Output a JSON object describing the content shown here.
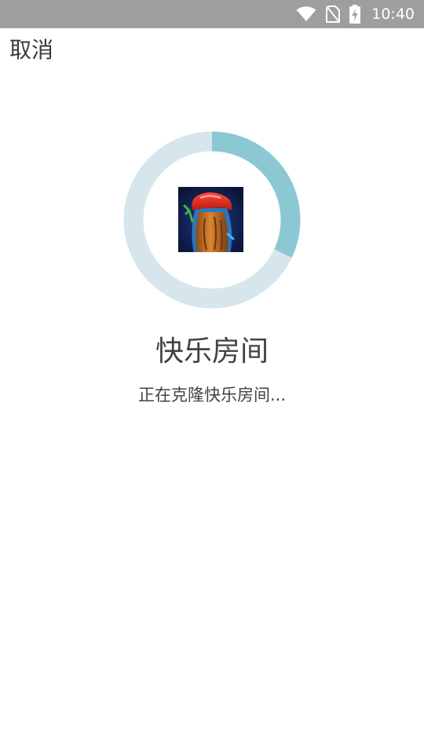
{
  "status_bar": {
    "time": "10:40",
    "icons": [
      "wifi-icon",
      "no-sim-icon",
      "battery-charging-icon"
    ],
    "background": "#9e9e9e"
  },
  "toolbar": {
    "cancel_label": "取消"
  },
  "progress": {
    "fraction": 0.32,
    "track_color": "#d6e6ec",
    "fill_color": "#8cc8d4"
  },
  "app": {
    "icon": "tree-stump-app-icon"
  },
  "room": {
    "title": "快乐房间",
    "status": "正在克隆快乐房间..."
  }
}
